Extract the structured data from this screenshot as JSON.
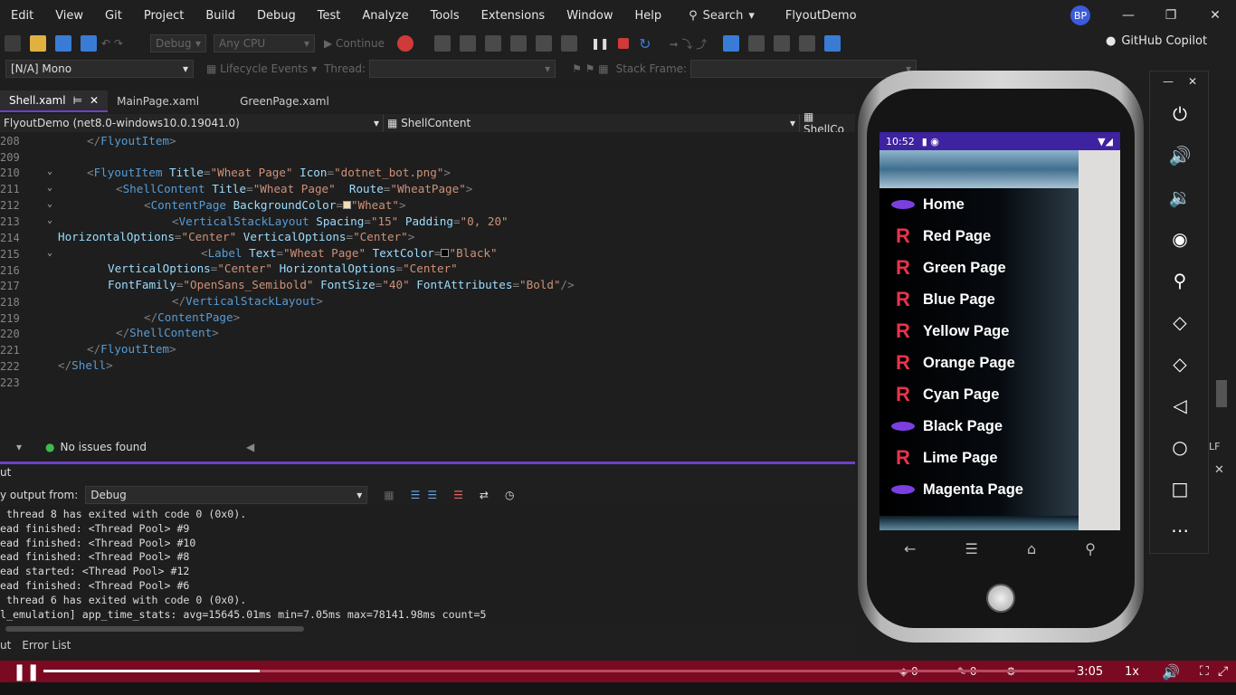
{
  "menubar": {
    "items": [
      "Edit",
      "View",
      "Git",
      "Project",
      "Build",
      "Debug",
      "Test",
      "Analyze",
      "Tools",
      "Extensions",
      "Window",
      "Help"
    ],
    "search_label": "Search",
    "title": "FlyoutDemo",
    "avatar": "BP"
  },
  "toolbar": {
    "config": "Debug",
    "platform": "Any CPU",
    "continue": "Continue",
    "copilot": "GitHub Copilot"
  },
  "toolbar2": {
    "process": "[N/A] Mono",
    "lifecycle": "Lifecycle Events",
    "thread": "Thread:",
    "stackframe": "Stack Frame:"
  },
  "tabs": [
    "Shell.xaml",
    "MainPage.xaml",
    "GreenPage.xaml"
  ],
  "navbar": {
    "project": "FlyoutDemo (net8.0-windows10.0.19041.0)",
    "member": "ShellContent",
    "member2": "ShellCo"
  },
  "code_lines": [
    {
      "n": "208",
      "t": "</FlyoutItem>"
    },
    {
      "n": "209",
      "t": ""
    },
    {
      "n": "210",
      "t": "<FlyoutItem Title=\"Wheat Page\" Icon=\"dotnet_bot.png\">"
    },
    {
      "n": "211",
      "t": "<ShellContent Title=\"Wheat Page\"  Route=\"WheatPage\">"
    },
    {
      "n": "212",
      "t": "<ContentPage BackgroundColor=\"Wheat\">"
    },
    {
      "n": "213",
      "t": "<VerticalStackLayout Spacing=\"15\" Padding=\"0, 20\""
    },
    {
      "n": "214",
      "t": "HorizontalOptions=\"Center\" VerticalOptions=\"Center\">"
    },
    {
      "n": "215",
      "t": "<Label Text=\"Wheat Page\" TextColor=\"Black\""
    },
    {
      "n": "216",
      "t": "VerticalOptions=\"Center\" HorizontalOptions=\"Center\""
    },
    {
      "n": "217",
      "t": "FontFamily=\"OpenSans_Semibold\" FontSize=\"40\" FontAttributes=\"Bold\"/>"
    },
    {
      "n": "218",
      "t": "</VerticalStackLayout>"
    },
    {
      "n": "219",
      "t": "</ContentPage>"
    },
    {
      "n": "220",
      "t": "</ShellContent>"
    },
    {
      "n": "221",
      "t": "</FlyoutItem>"
    },
    {
      "n": "222",
      "t": "</Shell>"
    },
    {
      "n": "223",
      "t": ""
    }
  ],
  "status": {
    "issues": "No issues found"
  },
  "output": {
    "header": "ut",
    "show_from": "y output from:",
    "source": "Debug",
    "lines": [
      " thread 8 has exited with code 0 (0x0).",
      "ead finished: <Thread Pool> #9",
      "ead finished: <Thread Pool> #10",
      "ead finished: <Thread Pool> #8",
      "ead started: <Thread Pool> #12",
      "ead finished: <Thread Pool> #6",
      " thread 6 has exited with code 0 (0x0).",
      "l_emulation] app_time_stats: avg=15645.01ms min=7.05ms max=78141.98ms count=5"
    ]
  },
  "bottom_tabs": [
    "ut",
    "Error List"
  ],
  "phone": {
    "time": "10:52",
    "menu": [
      {
        "label": "Home",
        "icon": "dotnet-bot"
      },
      {
        "label": "Red Page",
        "icon": "R"
      },
      {
        "label": "Green Page",
        "icon": "R"
      },
      {
        "label": "Blue Page",
        "icon": "R"
      },
      {
        "label": "Yellow Page",
        "icon": "R"
      },
      {
        "label": "Orange Page",
        "icon": "R"
      },
      {
        "label": "Cyan Page",
        "icon": "R"
      },
      {
        "label": "Black Page",
        "icon": "dotnet-bot"
      },
      {
        "label": "Lime Page",
        "icon": "R"
      },
      {
        "label": "Magenta Page",
        "icon": "dotnet-bot"
      }
    ]
  },
  "player": {
    "time": "3:05",
    "speed": "1x",
    "progress": 0.21,
    "counts": [
      "0",
      "0"
    ]
  },
  "colors": {
    "accent": "#6e40c9",
    "player": "#7a0a22",
    "red_icon": "#e8334a",
    "android_status": "#3d23a0"
  }
}
